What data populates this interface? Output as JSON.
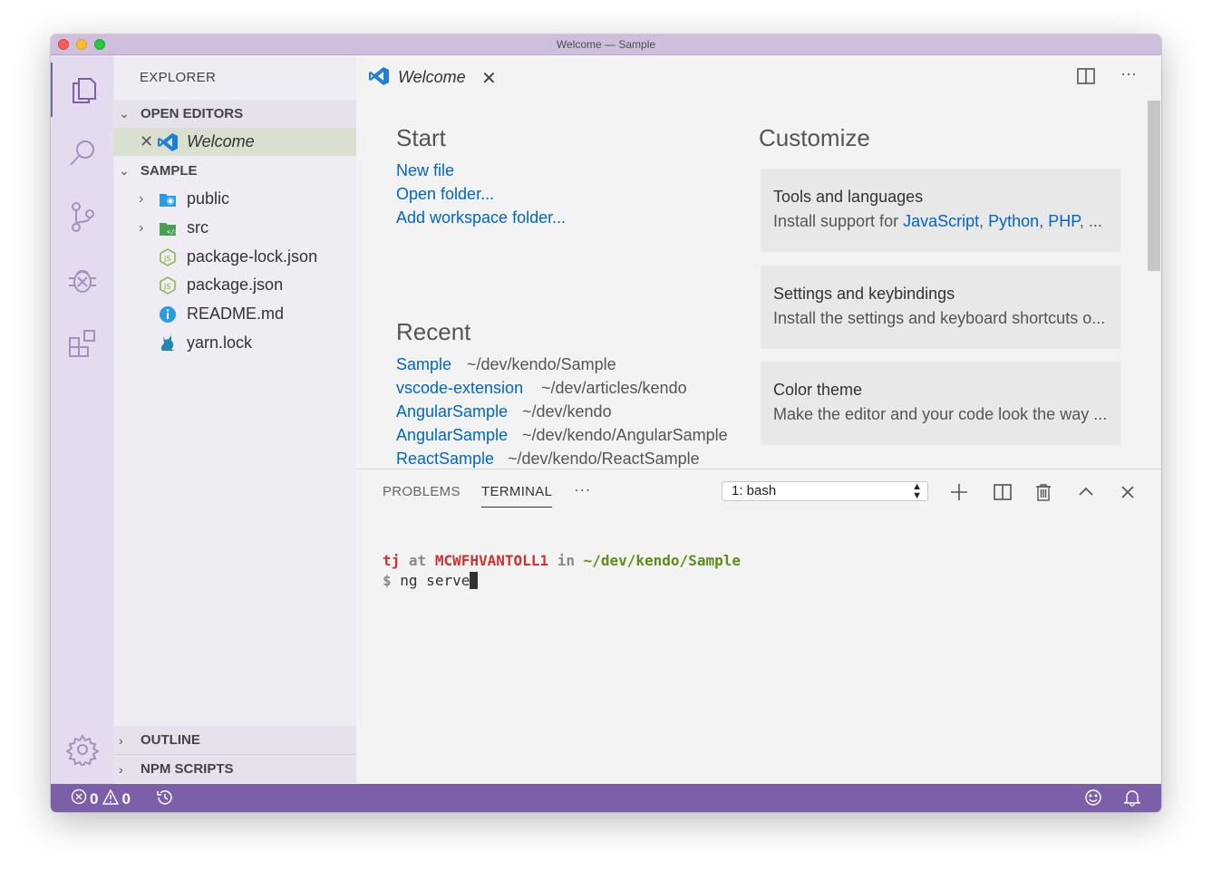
{
  "window": {
    "title": "Welcome — Sample"
  },
  "sidebar": {
    "title": "EXPLORER",
    "open_editors": {
      "label": "OPEN EDITORS",
      "items": [
        {
          "label": "Welcome"
        }
      ]
    },
    "workspace": {
      "label": "SAMPLE",
      "items": [
        {
          "label": "public",
          "type": "folder"
        },
        {
          "label": "src",
          "type": "folder"
        },
        {
          "label": "package-lock.json",
          "type": "file"
        },
        {
          "label": "package.json",
          "type": "file"
        },
        {
          "label": "README.md",
          "type": "file"
        },
        {
          "label": "yarn.lock",
          "type": "file"
        }
      ]
    },
    "outline_label": "OUTLINE",
    "npm_scripts_label": "NPM SCRIPTS"
  },
  "editor": {
    "tab_label": "Welcome",
    "start": {
      "heading": "Start",
      "links": [
        "New file",
        "Open folder...",
        "Add workspace folder..."
      ]
    },
    "recent": {
      "heading": "Recent",
      "items": [
        {
          "name": "Sample",
          "path": "~/dev/kendo/Sample"
        },
        {
          "name": "vscode-extension",
          "path": "~/dev/articles/kendo"
        },
        {
          "name": "AngularSample",
          "path": "~/dev/kendo"
        },
        {
          "name": "AngularSample",
          "path": "~/dev/kendo/AngularSample"
        },
        {
          "name": "ReactSample",
          "path": "~/dev/kendo/ReactSample"
        }
      ]
    },
    "customize": {
      "heading": "Customize",
      "cards": [
        {
          "title": "Tools and languages",
          "desc_prefix": "Install support for ",
          "links": [
            "JavaScript",
            "Python",
            "PHP"
          ],
          "desc_suffix": ", ...",
          "sep": ", "
        },
        {
          "title": "Settings and keybindings",
          "desc": "Install the settings and keyboard shortcuts o..."
        },
        {
          "title": "Color theme",
          "desc": "Make the editor and your code look the way ..."
        }
      ]
    }
  },
  "panel": {
    "tabs": [
      "PROBLEMS",
      "TERMINAL"
    ],
    "more": "···",
    "terminal_select": "1: bash",
    "terminal": {
      "user": "tj",
      "at": "at",
      "host": "MCWFHVANTOLL1",
      "in": "in",
      "path": "~/dev/kendo/Sample",
      "prompt": "$",
      "command": "ng serve"
    }
  },
  "statusbar": {
    "errors": "0",
    "warnings": "0"
  },
  "colors": {
    "accent": "#7b5fa8",
    "link": "#0066bf",
    "titlebar": "#cfbfdc"
  }
}
